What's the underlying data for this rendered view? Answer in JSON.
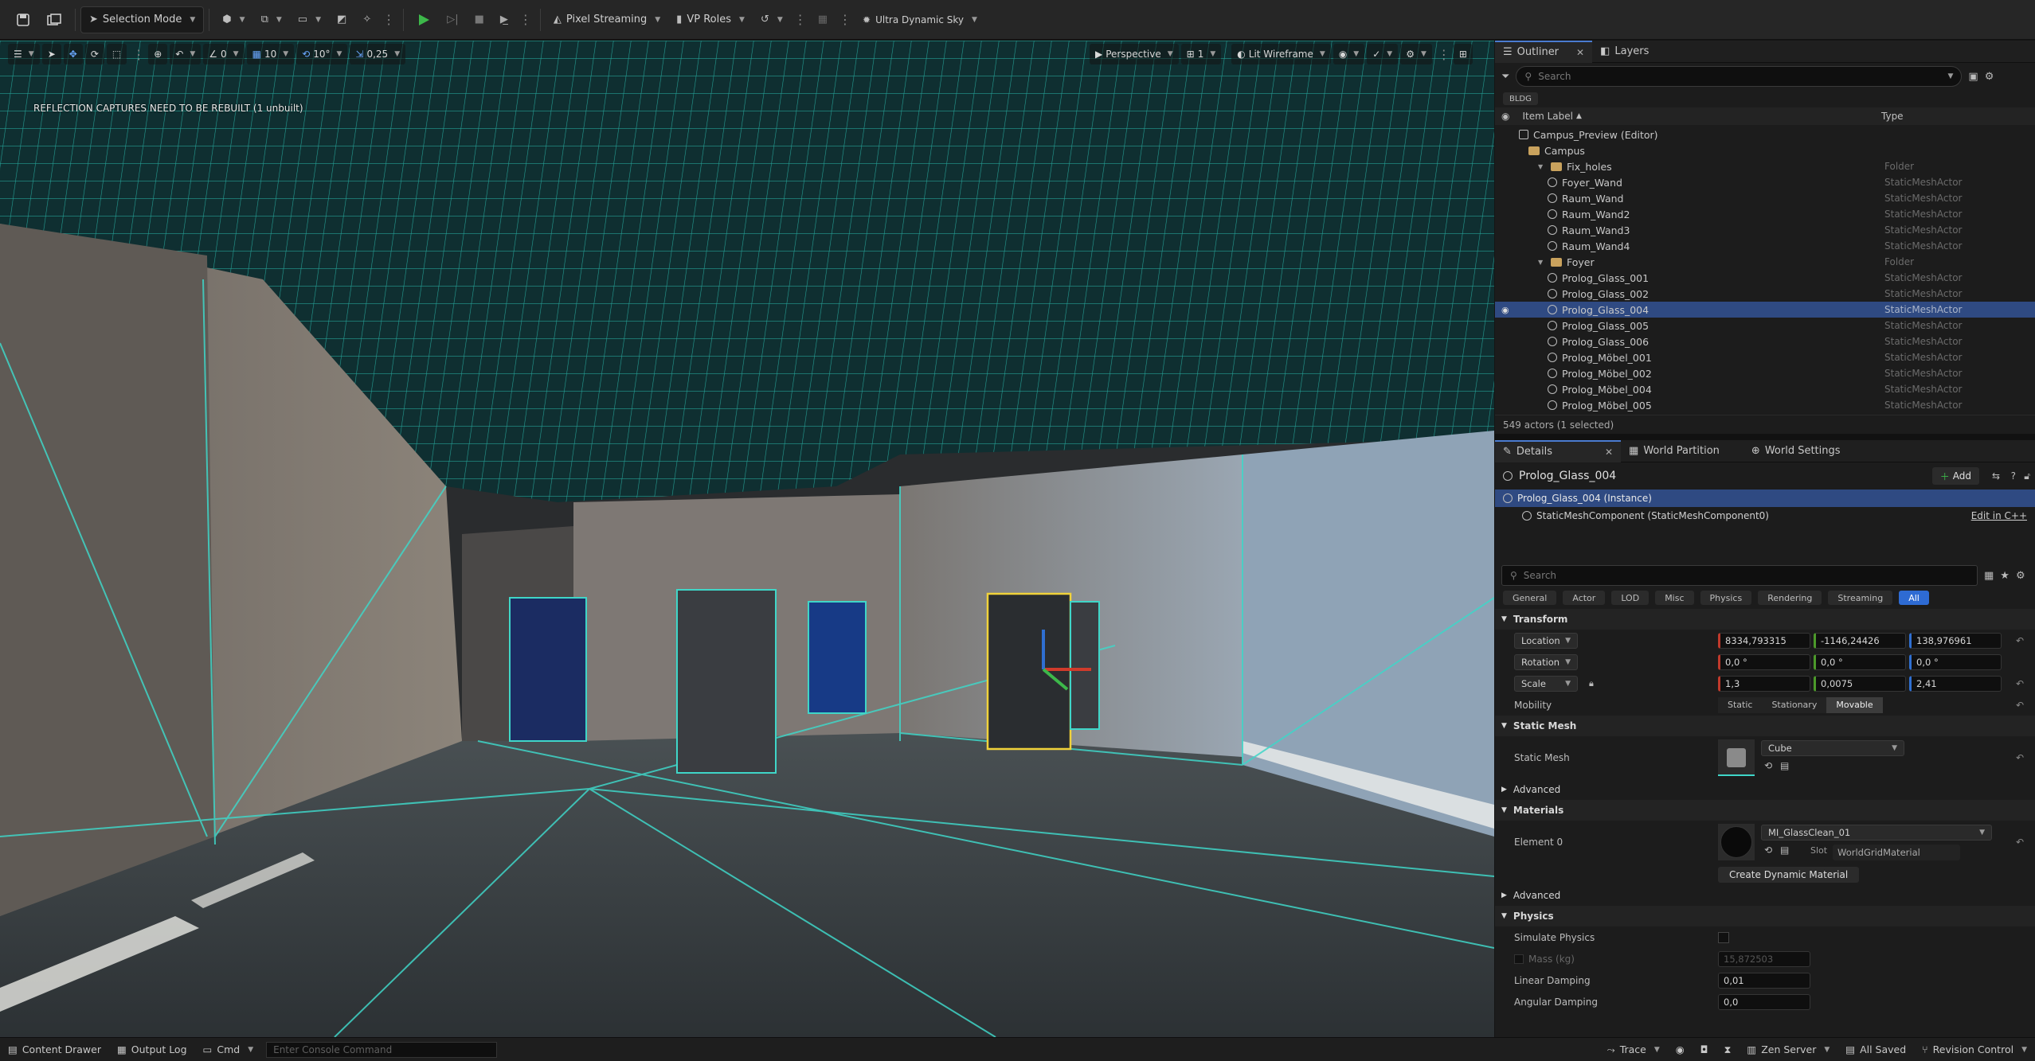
{
  "toolbar": {
    "selection_mode": "Selection Mode",
    "pixel_streaming": "Pixel Streaming",
    "vp_roles": "VP Roles",
    "sky": "Ultra Dynamic Sky"
  },
  "viewport": {
    "grid_snap": "10",
    "rot_snap": "10°",
    "scale_snap": "0,25",
    "angle_num": "0",
    "perspective": "Perspective",
    "cam_count": "1",
    "view_mode": "Lit Wireframe",
    "warning": "REFLECTION CAPTURES NEED TO BE REBUILT (1 unbuilt)"
  },
  "outliner": {
    "tab_outliner": "Outliner",
    "tab_layers": "Layers",
    "search_placeholder": "Search",
    "filter_chip": "BLDG",
    "col_label": "Item Label",
    "col_type": "Type",
    "rows": [
      {
        "label": "Campus_Preview (Editor)",
        "type": "",
        "icon": "level-icon",
        "indent": 2
      },
      {
        "label": "Campus",
        "type": "",
        "icon": "folder-icon",
        "indent": 3
      },
      {
        "label": "Fix_holes",
        "type": "Folder",
        "icon": "folder-icon",
        "indent": 4
      },
      {
        "label": "Foyer_Wand",
        "type": "StaticMeshActor",
        "icon": "mesh-icon",
        "indent": 5
      },
      {
        "label": "Raum_Wand",
        "type": "StaticMeshActor",
        "icon": "mesh-icon",
        "indent": 5
      },
      {
        "label": "Raum_Wand2",
        "type": "StaticMeshActor",
        "icon": "mesh-icon",
        "indent": 5
      },
      {
        "label": "Raum_Wand3",
        "type": "StaticMeshActor",
        "icon": "mesh-icon",
        "indent": 5
      },
      {
        "label": "Raum_Wand4",
        "type": "StaticMeshActor",
        "icon": "mesh-icon",
        "indent": 5
      },
      {
        "label": "Foyer",
        "type": "Folder",
        "icon": "folder-icon",
        "indent": 4
      },
      {
        "label": "Prolog_Glass_001",
        "type": "StaticMeshActor",
        "icon": "mesh-icon",
        "indent": 5
      },
      {
        "label": "Prolog_Glass_002",
        "type": "StaticMeshActor",
        "icon": "mesh-icon",
        "indent": 5
      },
      {
        "label": "Prolog_Glass_004",
        "type": "StaticMeshActor",
        "icon": "mesh-icon",
        "indent": 5,
        "selected": true
      },
      {
        "label": "Prolog_Glass_005",
        "type": "StaticMeshActor",
        "icon": "mesh-icon",
        "indent": 5
      },
      {
        "label": "Prolog_Glass_006",
        "type": "StaticMeshActor",
        "icon": "mesh-icon",
        "indent": 5
      },
      {
        "label": "Prolog_Möbel_001",
        "type": "StaticMeshActor",
        "icon": "mesh-icon",
        "indent": 5
      },
      {
        "label": "Prolog_Möbel_002",
        "type": "StaticMeshActor",
        "icon": "mesh-icon",
        "indent": 5
      },
      {
        "label": "Prolog_Möbel_004",
        "type": "StaticMeshActor",
        "icon": "mesh-icon",
        "indent": 5
      },
      {
        "label": "Prolog_Möbel_005",
        "type": "StaticMeshActor",
        "icon": "mesh-icon",
        "indent": 5
      }
    ],
    "footer": "549 actors (1 selected)"
  },
  "details": {
    "tab_details": "Details",
    "tab_world_partition": "World Partition",
    "tab_world_settings": "World Settings",
    "actor_name": "Prolog_Glass_004",
    "add_label": "Add",
    "instance": "Prolog_Glass_004 (Instance)",
    "component": "StaticMeshComponent (StaticMeshComponent0)",
    "edit_cpp": "Edit in C++",
    "search_placeholder": "Search",
    "filters": [
      "General",
      "Actor",
      "LOD",
      "Misc",
      "Physics",
      "Rendering",
      "Streaming",
      "All"
    ],
    "transform": {
      "header": "Transform",
      "location_label": "Location",
      "rotation_label": "Rotation",
      "scale_label": "Scale",
      "location": [
        "8334,793315",
        "-1146,24426",
        "138,976961"
      ],
      "rotation": [
        "0,0 °",
        "0,0 °",
        "0,0 °"
      ],
      "scale": [
        "1,3",
        "0,0075",
        "2,41"
      ],
      "mobility_label": "Mobility",
      "mobility": [
        "Static",
        "Stationary",
        "Movable"
      ]
    },
    "static_mesh": {
      "header": "Static Mesh",
      "label": "Static Mesh",
      "value": "Cube",
      "advanced": "Advanced"
    },
    "materials": {
      "header": "Materials",
      "element_label": "Element 0",
      "value": "MI_GlassClean_01",
      "slot_label": "Slot",
      "slot_value": "WorldGridMaterial",
      "create_button": "Create Dynamic Material",
      "advanced": "Advanced"
    },
    "physics": {
      "header": "Physics",
      "simulate_label": "Simulate Physics",
      "mass_label": "Mass (kg)",
      "mass_value": "15,872503",
      "linear_label": "Linear Damping",
      "linear_value": "0,01",
      "angular_label": "Angular Damping",
      "angular_value": "0,0"
    }
  },
  "statusbar": {
    "content_drawer": "Content Drawer",
    "output_log": "Output Log",
    "cmd": "Cmd",
    "console_placeholder": "Enter Console Command",
    "trace": "Trace",
    "zen_server": "Zen Server",
    "all_saved": "All Saved",
    "revision_control": "Revision Control"
  },
  "colors": {
    "wire": "#3fd6c8",
    "selection": "#2f4a82",
    "accent_blue": "#2e6bd3",
    "play_green": "#3db84a"
  }
}
